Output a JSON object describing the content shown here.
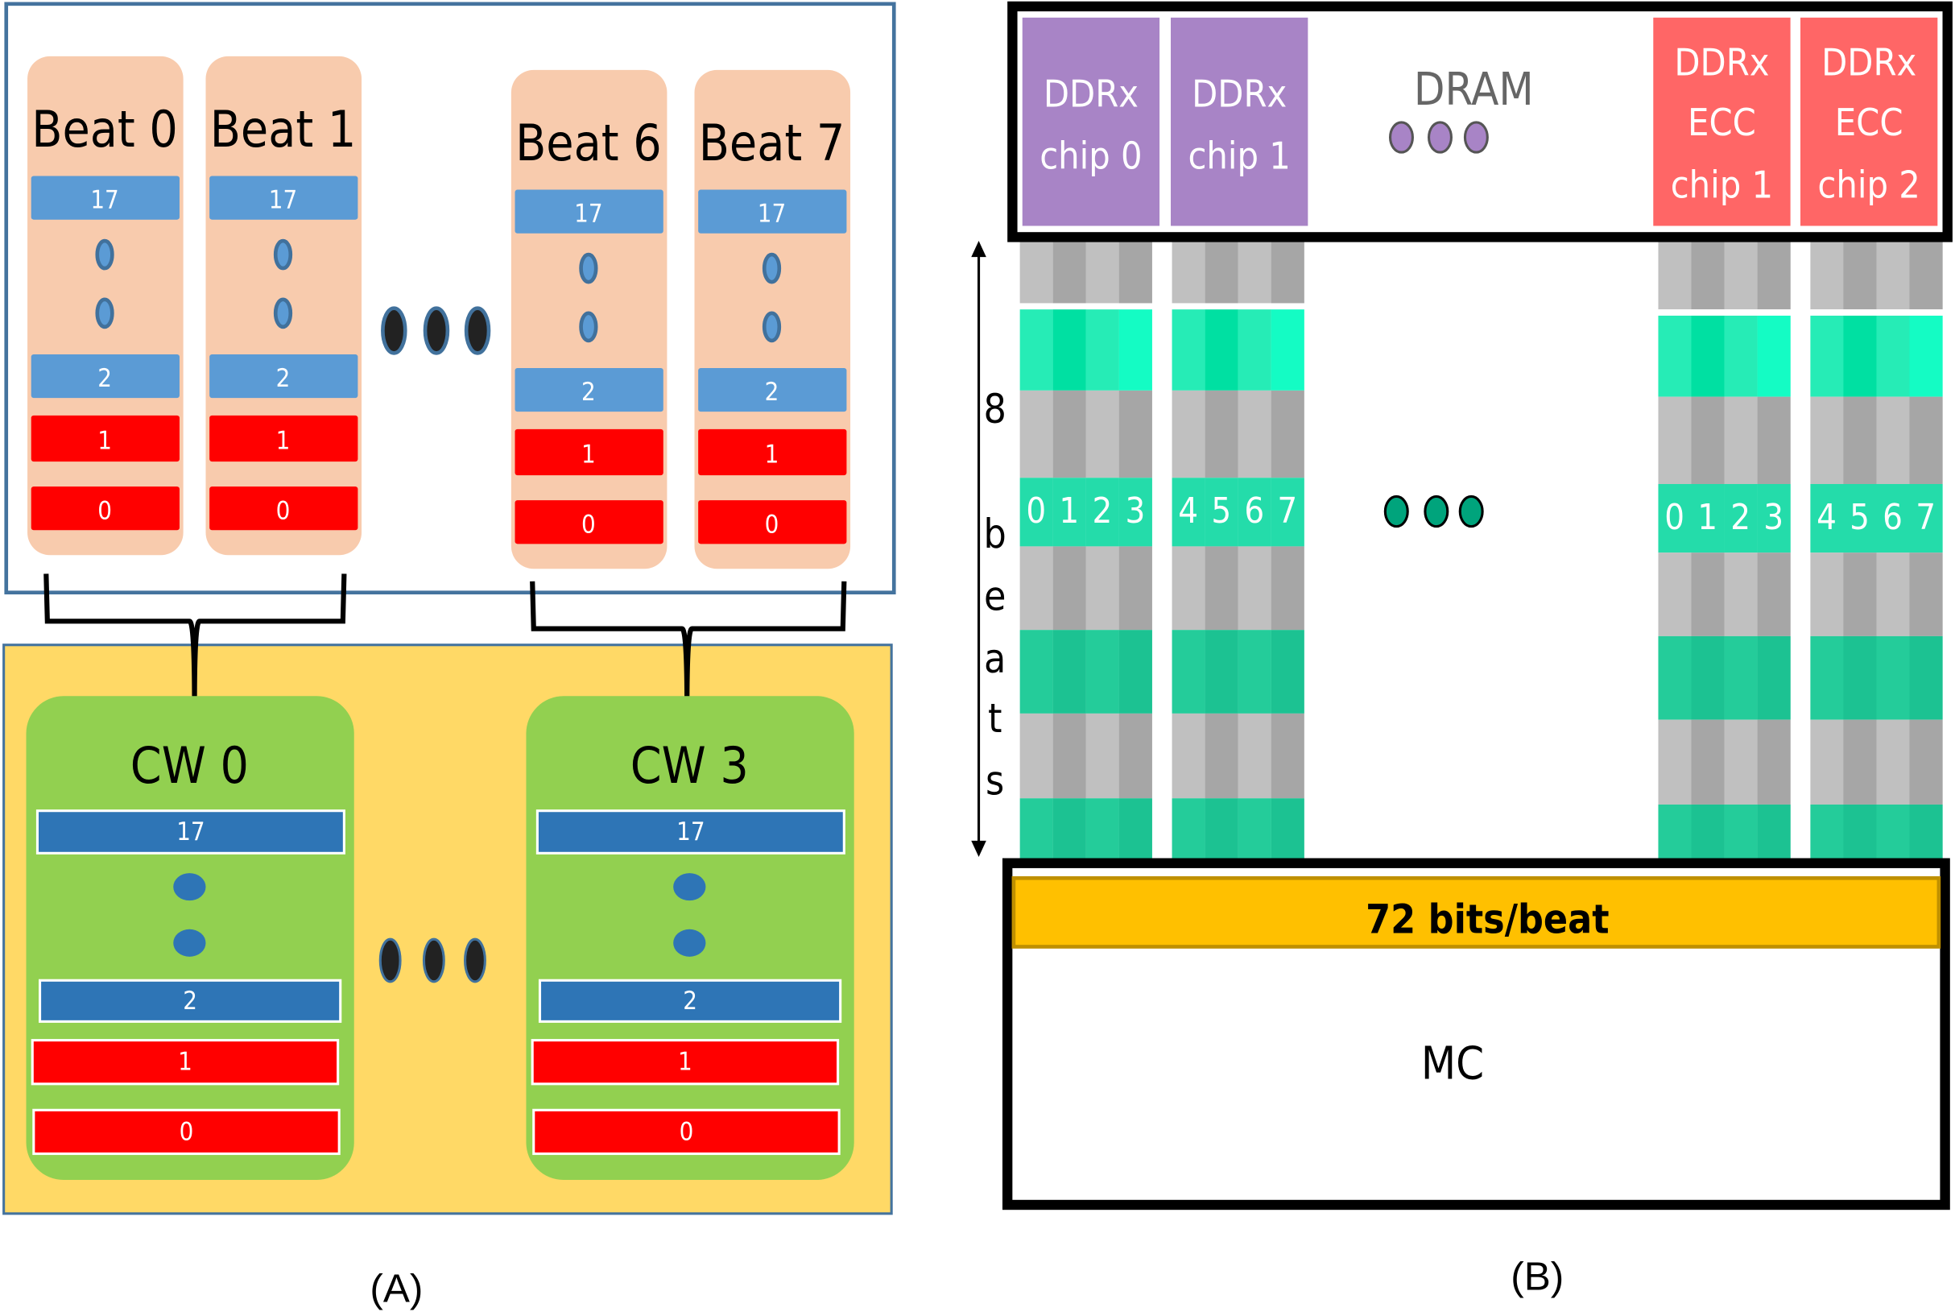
{
  "panel_a": {
    "label": "(A)",
    "beats": [
      {
        "title": "Beat 0",
        "bars": [
          "17",
          "2",
          "1",
          "0"
        ]
      },
      {
        "title": "Beat 1",
        "bars": [
          "17",
          "2",
          "1",
          "0"
        ]
      },
      {
        "title": "Beat 6",
        "bars": [
          "17",
          "2",
          "1",
          "0"
        ]
      },
      {
        "title": "Beat 7",
        "bars": [
          "17",
          "2",
          "1",
          "0"
        ]
      }
    ],
    "codewords": [
      {
        "title": "CW 0",
        "bars": [
          "17",
          "2",
          "1",
          "0"
        ]
      },
      {
        "title": "CW 3",
        "bars": [
          "17",
          "2",
          "1",
          "0"
        ]
      }
    ]
  },
  "panel_b": {
    "label": "(B)",
    "chips": [
      {
        "lines": [
          "DDRx",
          "chip 0"
        ],
        "kind": "data"
      },
      {
        "lines": [
          "DDRx",
          "chip 1"
        ],
        "kind": "data"
      },
      {
        "lines": [
          "DDRx",
          "ECC",
          "chip 1"
        ],
        "kind": "ecc"
      },
      {
        "lines": [
          "DDRx",
          "ECC",
          "chip 2"
        ],
        "kind": "ecc"
      }
    ],
    "dram_label": "DRAM",
    "column_labels": [
      [
        "0",
        "1",
        "2",
        "3"
      ],
      [
        "4",
        "5",
        "6",
        "7"
      ],
      [
        "0",
        "1",
        "2",
        "3"
      ],
      [
        "4",
        "5",
        "6",
        "7"
      ]
    ],
    "beats_letters": [
      "8",
      "b",
      "e",
      "a",
      "t",
      "s"
    ],
    "bus_label": "72 bits/beat",
    "mc_label": "MC"
  },
  "colors": {
    "beat_card": "#f8cbad",
    "beat_blue": "#5b9bd5",
    "red": "#ff0000",
    "cw_card": "#92d050",
    "cw_blue": "#2e75b6",
    "yellow_bg": "#ffd966",
    "box_border": "#44739e",
    "chip_data": "#a884c6",
    "chip_ecc": "#ff6666",
    "green_cell": "#22e4ad",
    "gray_cell": "#b8b8b8",
    "bus": "#ffc000",
    "dot_green": "#00a47c"
  }
}
